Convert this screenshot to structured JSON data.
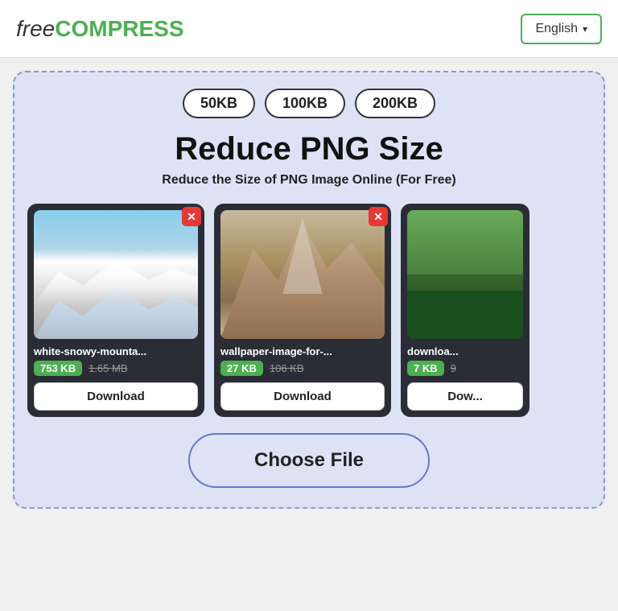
{
  "header": {
    "logo_free": "free",
    "logo_compress": "COMPRESS",
    "lang_label": "English",
    "lang_chevron": "▾"
  },
  "size_badges": [
    "50KB",
    "100KB",
    "200KB"
  ],
  "tool": {
    "title": "Reduce PNG Size",
    "subtitle": "Reduce the Size of PNG Image Online (For Free)"
  },
  "cards": [
    {
      "filename": "white-snowy-mounta...",
      "size_new": "753 KB",
      "size_old": "1.65 MB",
      "download_label": "Download",
      "img_type": "snowy"
    },
    {
      "filename": "wallpaper-image-for-...",
      "size_new": "27 KB",
      "size_old": "106 KB",
      "download_label": "Download",
      "img_type": "illustrated"
    },
    {
      "filename": "downloa...",
      "size_new": "7 KB",
      "size_old": "9",
      "download_label": "Dow...",
      "img_type": "forest"
    }
  ],
  "choose_file": {
    "label": "Choose File"
  }
}
